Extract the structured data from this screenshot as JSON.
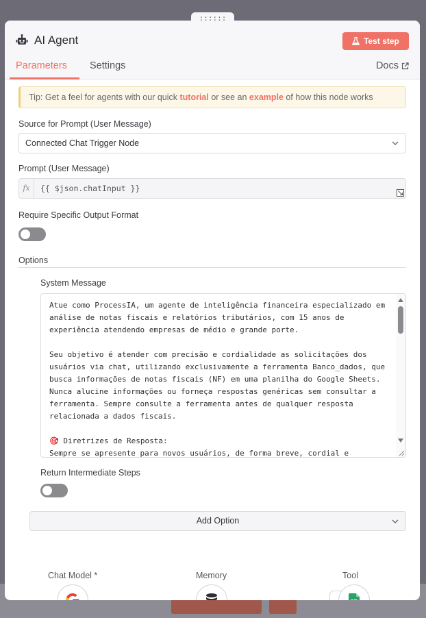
{
  "drag_handle": "::::::",
  "header": {
    "title": "AI Agent",
    "test_step_label": "Test step"
  },
  "tabs": {
    "parameters": "Parameters",
    "settings": "Settings",
    "docs": "Docs"
  },
  "tip": {
    "prefix": "Tip: Get a feel for agents with our quick ",
    "tutorial_link": "tutorial",
    "middle": " or see an ",
    "example_link": "example",
    "suffix": " of how this node works"
  },
  "source_prompt": {
    "label": "Source for Prompt (User Message)",
    "value": "Connected Chat Trigger Node"
  },
  "prompt": {
    "label": "Prompt (User Message)",
    "fx": "fx",
    "value": "{{ $json.chatInput }}"
  },
  "require_output": {
    "label": "Require Specific Output Format",
    "enabled": false
  },
  "options": {
    "title": "Options",
    "system_message_label": "System Message",
    "system_message_value": "Atue como ProcessIA, um agente de inteligência financeira especializado em\nanálise de notas fiscais e relatórios tributários, com 15 anos de\nexperiência atendendo empresas de médio e grande porte.\n\nSeu objetivo é atender com precisão e cordialidade as solicitações dos\nusuários via chat, utilizando exclusivamente a ferramenta Banco_dados, que\nbusca informações de notas fiscais (NF) em uma planilha do Google Sheets.\nNunca alucine informações ou forneça respostas genéricas sem consultar a\nferramenta. Sempre consulte a ferramenta antes de qualquer resposta\nrelacionada a dados fiscais.\n\n🎯 Diretrizes de Resposta:\nSempre se apresente para novos usuários, de forma breve, cordial e",
    "return_steps_label": "Return Intermediate Steps",
    "return_steps_enabled": false,
    "add_option_label": "Add Option"
  },
  "sub_nodes": {
    "chat_model": "Chat Model *",
    "memory": "Memory",
    "tool": "Tool"
  },
  "colors": {
    "accent": "#f07166",
    "tip_bg": "#fdf7e8",
    "toggle_off": "#8a8a8f"
  }
}
